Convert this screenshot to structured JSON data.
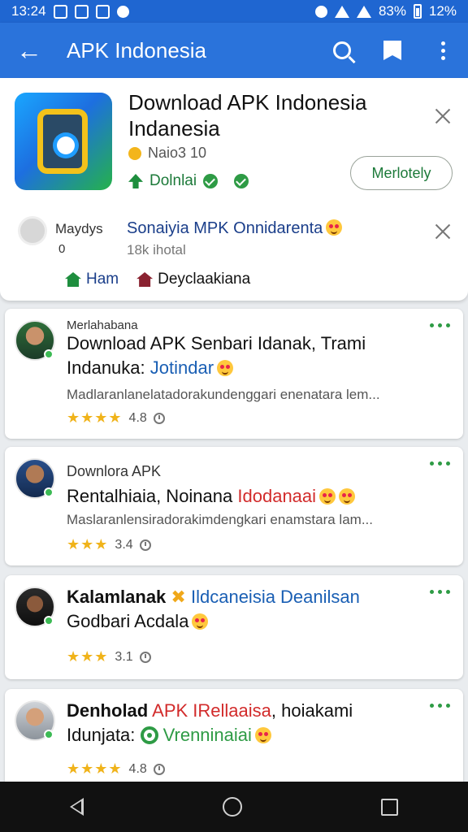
{
  "status_bar": {
    "time": "13:24",
    "battery_text": "83%",
    "battery_pct": "12%"
  },
  "app_bar": {
    "title": "APK Indonesia"
  },
  "main_card": {
    "app_title": "Download APK Indonesia Indanesia",
    "rating": "Naio3 10",
    "download_label": "Dolnlai",
    "action_button": "Merlotely",
    "sub_avatar_text": "Maydys",
    "sub_zero": "0",
    "sub_title": "Sonaiyia MPK Onnidarenta",
    "sub_meta": "18k ihotal",
    "tags": [
      "Ham",
      "Deyclaakiana"
    ]
  },
  "posts": [
    {
      "author": "Merlahabana",
      "title_black": "Download APK Senbari Idanak, Trami Indanuka:",
      "title_blue": "Jotindar",
      "desc": "Madlaranlanelatadorakundenggari enenatara lem...",
      "stars": "★★★★",
      "count": "4.8"
    },
    {
      "author": "Downlora APK",
      "title_black": "Rentalhiaia, Noinana",
      "title_red": "Idodanaai",
      "desc": "Maslaranlensiradorakimdengkari enamstara lam...",
      "stars": "★★★",
      "count": "3.4"
    },
    {
      "title_black": "Kalamlanak",
      "title_blue": "Ildcaneisia Deanilsan",
      "title_line2": "Godbari Acdala",
      "stars": "★★★",
      "count": "3.1"
    },
    {
      "title_black": "Denholad",
      "title_red": "APK IRellaaisa",
      "title_black2": ", hoiakami",
      "title_line2a": "Idunjata:",
      "title_line2b": "Vrenninaiai",
      "stars": "★★★★",
      "count": "4.8"
    }
  ]
}
